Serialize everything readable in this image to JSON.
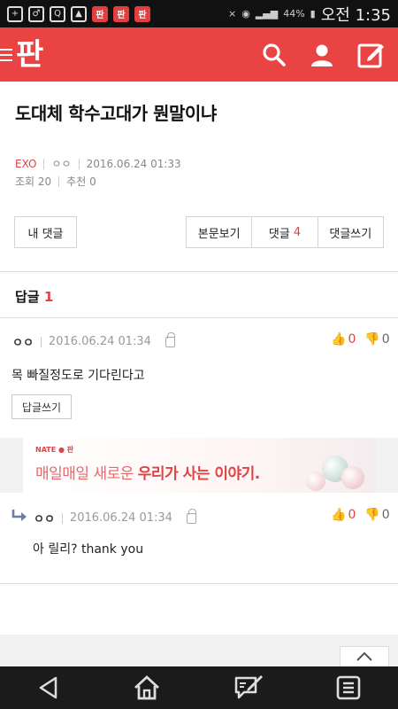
{
  "status_bar": {
    "battery": "44%",
    "clock": "오전 1:35",
    "app_badges": [
      "판",
      "판",
      "판"
    ]
  },
  "app": {
    "logo": "판"
  },
  "post": {
    "title": "도대체 학수고대가 뭔말이냐",
    "category": "EXO",
    "author": "ㅇㅇ",
    "date": "2016.06.24 01:33",
    "views_label": "조회 20",
    "recommend_label": "추천 0"
  },
  "buttons": {
    "my_comments": "내 댓글",
    "view_body": "본문보기",
    "comments_label": "댓글",
    "comments_count": "4",
    "write_comment": "댓글쓰기"
  },
  "replies_section": {
    "label": "답글",
    "count": "1"
  },
  "comments": [
    {
      "author": "ㅇㅇ",
      "date": "2016.06.24 01:34",
      "body": "목 빠질정도로 기다린다고",
      "likes": "0",
      "dislikes": "0",
      "reply_button": "답글쓰기"
    },
    {
      "author": "ㅇㅇ",
      "date": "2016.06.24 01:34",
      "body": "아 릴리? thank you",
      "likes": "0",
      "dislikes": "0"
    }
  ],
  "ad": {
    "brand": "NATE ● 판",
    "text_plain": "매일매일 새로운 ",
    "text_bold": "우리가 사는 이야기."
  },
  "colors": {
    "brand_red": "#e94343",
    "accent_red": "#e14343"
  }
}
